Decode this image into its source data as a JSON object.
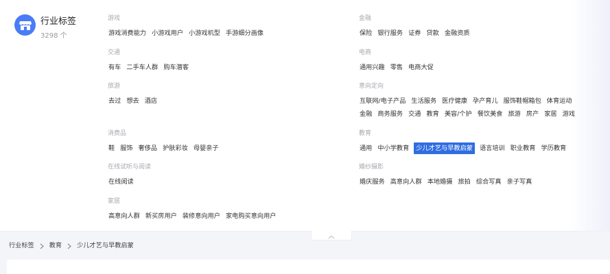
{
  "brand": {
    "title": "行业标签",
    "count": "3298 个"
  },
  "groups": {
    "game": {
      "title": "游戏",
      "rows": [
        [
          "游戏消费能力",
          "小游戏用户",
          "小游戏机型",
          "手游细分画像"
        ]
      ]
    },
    "finance": {
      "title": "金融",
      "rows": [
        [
          "保险",
          "银行服务",
          "证券",
          "贷款",
          "金融资质"
        ]
      ]
    },
    "traffic": {
      "title": "交通",
      "rows": [
        [
          "有车",
          "二手车人群",
          "购车潜客"
        ]
      ]
    },
    "ecommerce": {
      "title": "电商",
      "rows": [
        [
          "通用兴趣",
          "零售",
          "电商大促"
        ]
      ]
    },
    "travel": {
      "title": "旅游",
      "rows": [
        [
          "去过",
          "想去",
          "酒店"
        ]
      ]
    },
    "intent": {
      "title": "意向定向",
      "rows": [
        [
          "互联网/电子产品",
          "生活服务",
          "医疗健康",
          "孕产育儿",
          "服饰鞋帽箱包",
          "体育运动"
        ],
        [
          "金融",
          "商务服务",
          "交通",
          "教育",
          "美容/个护",
          "餐饮美食",
          "旅游",
          "房产",
          "家居",
          "游戏"
        ]
      ]
    },
    "consumer": {
      "title": "消费品",
      "rows": [
        [
          "鞋",
          "服饰",
          "奢侈品",
          "护肤彩妆",
          "母婴亲子"
        ]
      ]
    },
    "education": {
      "title": "教育",
      "rows": [
        [
          "通用",
          "中小学教育",
          "少儿才艺与早教启蒙",
          "语言培训",
          "职业教育",
          "学历教育"
        ]
      ],
      "active": "少儿才艺与早教启蒙"
    },
    "online": {
      "title": "在线试听与阅读",
      "rows": [
        [
          "在线阅读"
        ]
      ]
    },
    "wedding": {
      "title": "婚纱摄影",
      "rows": [
        [
          "婚庆服务",
          "高意向人群",
          "本地婚摄",
          "旅拍",
          "综合写真",
          "亲子写真"
        ]
      ]
    },
    "home": {
      "title": "家居",
      "rows": [
        [
          "高意向人群",
          "新买房用户",
          "装修意向用户",
          "家电购买意向用户"
        ]
      ]
    }
  },
  "breadcrumb": [
    "行业标签",
    "教育",
    "少儿才艺与早教启蒙"
  ],
  "icons": {
    "logo": "store-icon",
    "collapse": "chevron-up-icon",
    "separator": "chevron-right-icon"
  },
  "colors": {
    "accent": "#2f6de0",
    "logo": "#4a7cf6"
  }
}
